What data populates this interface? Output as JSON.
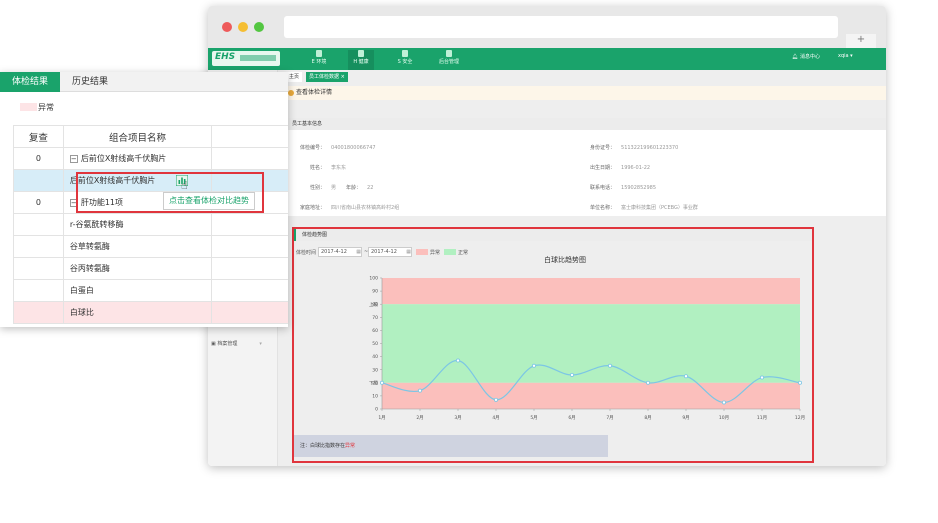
{
  "appbar": {
    "logo": "EHS",
    "nav": [
      "E 环境",
      "H 健康",
      "S 安全",
      "后台管理"
    ],
    "messages": "消息中心",
    "user": "xqia"
  },
  "side": {
    "archive": "档案管理"
  },
  "main": {
    "tabs": [
      "主页",
      "员工体检数据 ×"
    ],
    "breadcrumb": "查看体检详情"
  },
  "basic": {
    "title": "员工基本信息",
    "fields": [
      {
        "label": "体检编号：",
        "value": "04001800066747"
      },
      {
        "label": "身份证号：",
        "value": "511322199601223370"
      },
      {
        "label": "姓名：",
        "value": "李东东"
      },
      {
        "label": "出生日期：",
        "value": "1996-01-22"
      },
      {
        "label": "性别：",
        "value": "男"
      },
      {
        "label": "年龄：",
        "value": "22"
      },
      {
        "label": "联系电话：",
        "value": "15902852985"
      },
      {
        "label": "家庭地址：",
        "value": "四川省南山县农林镇高岭村2组"
      },
      {
        "label": "单位名称：",
        "value": "富士康科技集团（PCEBG）事业群"
      }
    ]
  },
  "trend": {
    "title": "体检趋势图",
    "date_label": "体检时间",
    "date_from": "2017-4-12",
    "date_to": "2017-4-12",
    "legend_abnormal": "异常",
    "legend_normal": "正常",
    "chart_title": "白球比趋势图",
    "note_prefix": "注：白球比指数存在",
    "note_flag": "异常"
  },
  "chart_data": {
    "type": "line",
    "title": "白球比趋势图",
    "categories": [
      "1月",
      "2月",
      "3月",
      "4月",
      "5月",
      "6月",
      "7月",
      "8月",
      "9月",
      "10月",
      "11月",
      "12月"
    ],
    "values": [
      20,
      14,
      37,
      7,
      33,
      26,
      33,
      20,
      25,
      5,
      24,
      20
    ],
    "ylim": [
      0,
      100
    ],
    "yticks": [
      0,
      10,
      20,
      30,
      40,
      50,
      60,
      70,
      80,
      90,
      100
    ],
    "y_upper_label": "上限",
    "y_lower_label": "下限",
    "lower_limit": 20,
    "upper_limit": 80,
    "max": 100,
    "normal_color": "#b1f0c1",
    "abnormal_color": "#fbbfbc",
    "line_color": "#7cc6e5"
  },
  "left": {
    "tabs": [
      "体检结果",
      "历史结果"
    ],
    "legend": "异常",
    "headers": [
      "复查",
      "组合项目名称"
    ],
    "group1": {
      "q": "0",
      "name": "后前位X射线高千伏胸片",
      "child": "后前位X射线高千伏胸片"
    },
    "group2": {
      "q": "0",
      "name": "肝功能11项",
      "children": [
        "r-谷氨酰转移酶",
        "谷草转氨酶",
        "谷丙转氨酶",
        "白蛋白",
        "白球比"
      ]
    },
    "tooltip": "点击查看体检对比趋势"
  }
}
